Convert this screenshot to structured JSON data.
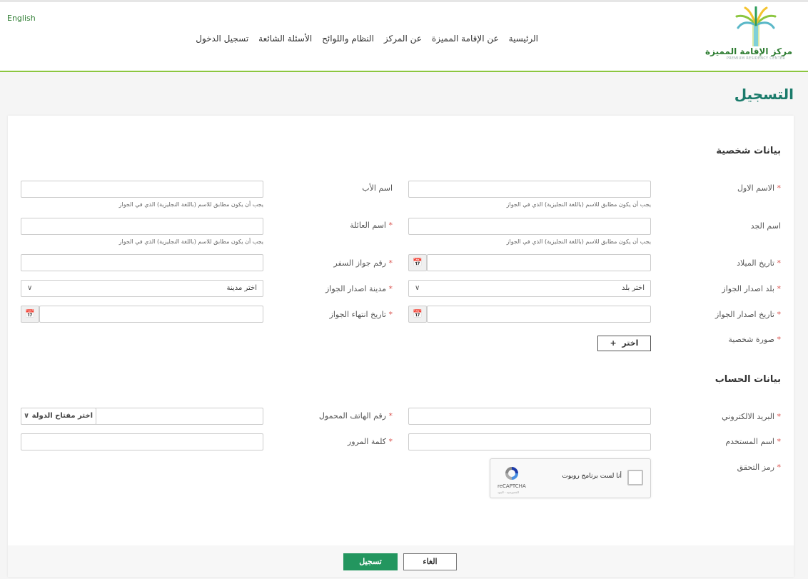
{
  "header": {
    "language_link": "English",
    "nav": [
      "الرئيسية",
      "عن الإقامة المميزة",
      "عن المركز",
      "النظام واللوائح",
      "الأسئلة الشائعة",
      "تسجيل الدخول"
    ],
    "logo_ar": "مركز الإقامة المميزة",
    "logo_en": "PREMIUM RESIDENCY CENTER"
  },
  "page_title": "التسجيل",
  "personal": {
    "section_title": "بيانات شخصية",
    "first_name": "الاسم الاول",
    "father_name": "اسم الأب",
    "grandfather_name": "اسم الجد",
    "family_name": "اسم العائلة",
    "birth_date": "تاريخ الميلاد",
    "passport_number": "رقم جواز السفر",
    "passport_country": "بلد اصدار الجواز",
    "passport_country_placeholder": "اختر بلد",
    "passport_city": "مدينة اصدار الجواز",
    "passport_city_placeholder": "اختر مدينة",
    "passport_issue_date": "تاريخ اصدار الجواز",
    "passport_expiry_date": "تاريخ انتهاء الجواز",
    "photo": "صورة شخصية",
    "choose_button": "اختر",
    "name_hint": "يجب أن يكون مطابق للاسم (باللغة النجليزية) الذي في الجواز"
  },
  "account": {
    "section_title": "بيانات الحساب",
    "email": "البريد الالكتروني",
    "mobile": "رقم الهاتف المحمول",
    "country_code_placeholder": "اختر مفتاح الدولة",
    "username": "اسم المستخدم",
    "password": "كلمة المرور",
    "captcha": "رمز التحقق"
  },
  "captcha": {
    "checkbox_label": "أنا لست برنامج روبوت",
    "brand": "reCAPTCHA",
    "terms": "الخصوصية - البنود"
  },
  "buttons": {
    "submit": "تسجيل",
    "cancel": "الغاء"
  },
  "required_mark": "*",
  "colors": {
    "accent_green": "#23965f",
    "title_teal": "#1b7b6b",
    "header_line": "#8cc63f",
    "required_red": "#d9534f"
  }
}
